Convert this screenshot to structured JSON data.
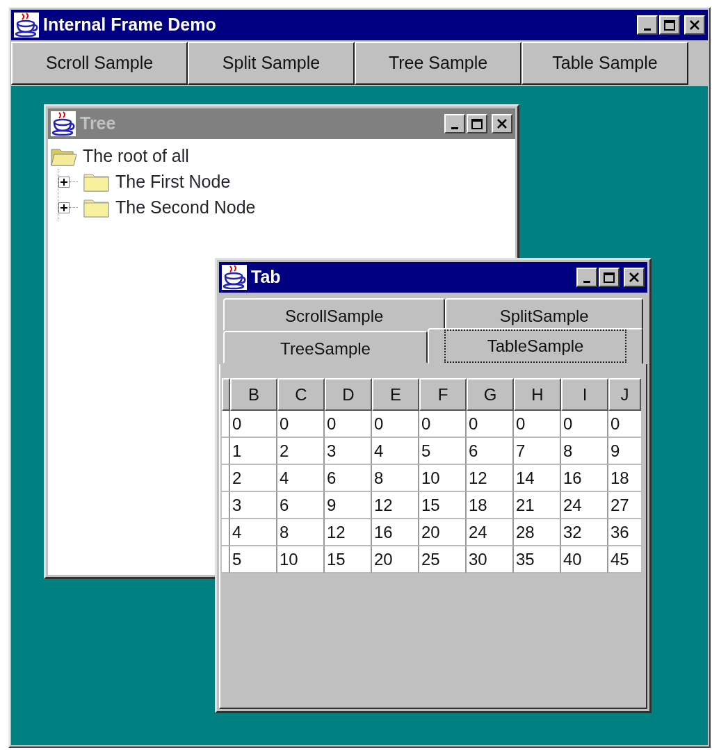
{
  "window": {
    "title": "Internal Frame Demo",
    "active": true
  },
  "toolbar": [
    {
      "label": "Scroll Sample"
    },
    {
      "label": "Split Sample"
    },
    {
      "label": "Tree Sample"
    },
    {
      "label": "Table Sample"
    }
  ],
  "frames": [
    {
      "kind": "tree",
      "title": "Tree",
      "active": false,
      "tree": {
        "label": "The root of all",
        "expanded": true,
        "children": [
          {
            "label": "The First Node",
            "expanded": false
          },
          {
            "label": "The Second Node",
            "expanded": false
          }
        ]
      }
    },
    {
      "kind": "tabs",
      "title": "Tab",
      "active": true,
      "tab_rows": [
        [
          {
            "label": "ScrollSample",
            "selected": false
          },
          {
            "label": "SplitSample",
            "selected": false
          }
        ],
        [
          {
            "label": "TreeSample",
            "selected": false
          },
          {
            "label": "TableSample",
            "selected": true
          }
        ]
      ],
      "table": {
        "columns": [
          "B",
          "C",
          "D",
          "E",
          "F",
          "G",
          "H",
          "I",
          "J"
        ],
        "rows": [
          [
            "0",
            "0",
            "0",
            "0",
            "0",
            "0",
            "0",
            "0",
            "0"
          ],
          [
            "1",
            "2",
            "3",
            "4",
            "5",
            "6",
            "7",
            "8",
            "9"
          ],
          [
            "2",
            "4",
            "6",
            "8",
            "10",
            "12",
            "14",
            "16",
            "18"
          ],
          [
            "3",
            "6",
            "9",
            "12",
            "15",
            "18",
            "21",
            "24",
            "27"
          ],
          [
            "4",
            "8",
            "12",
            "16",
            "20",
            "24",
            "28",
            "32",
            "36"
          ],
          [
            "5",
            "10",
            "15",
            "20",
            "25",
            "30",
            "35",
            "40",
            "45"
          ]
        ]
      }
    }
  ]
}
